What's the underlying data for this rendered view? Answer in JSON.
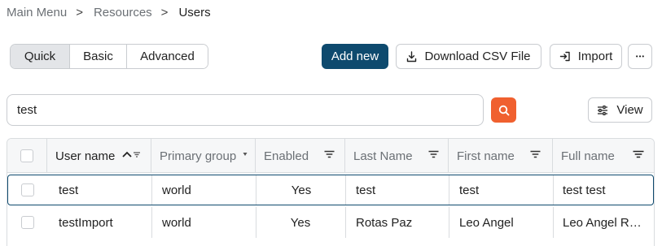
{
  "breadcrumb": {
    "items": [
      "Main Menu",
      "Resources",
      "Users"
    ],
    "separator": ">"
  },
  "view_tabs": [
    {
      "label": "Quick",
      "active": true
    },
    {
      "label": "Basic",
      "active": false
    },
    {
      "label": "Advanced",
      "active": false
    }
  ],
  "toolbar": {
    "add_label": "Add new",
    "download_label": "Download CSV File",
    "import_label": "Import",
    "more_label": "•••"
  },
  "search": {
    "value": "test",
    "placeholder": ""
  },
  "view_button": {
    "label": "View"
  },
  "table": {
    "columns": [
      "User name",
      "Primary group",
      "Enabled",
      "Last Name",
      "First name",
      "Full name"
    ],
    "rows": [
      [
        "test",
        "world",
        "Yes",
        "test",
        "test",
        "test test"
      ],
      [
        "testImport",
        "world",
        "Yes",
        "Rotas Paz",
        "Leo Angel",
        "Leo Angel R…"
      ]
    ],
    "selected_row": 0
  },
  "colors": {
    "primary": "#0e4a6e",
    "search_accent": "#f0602f"
  }
}
